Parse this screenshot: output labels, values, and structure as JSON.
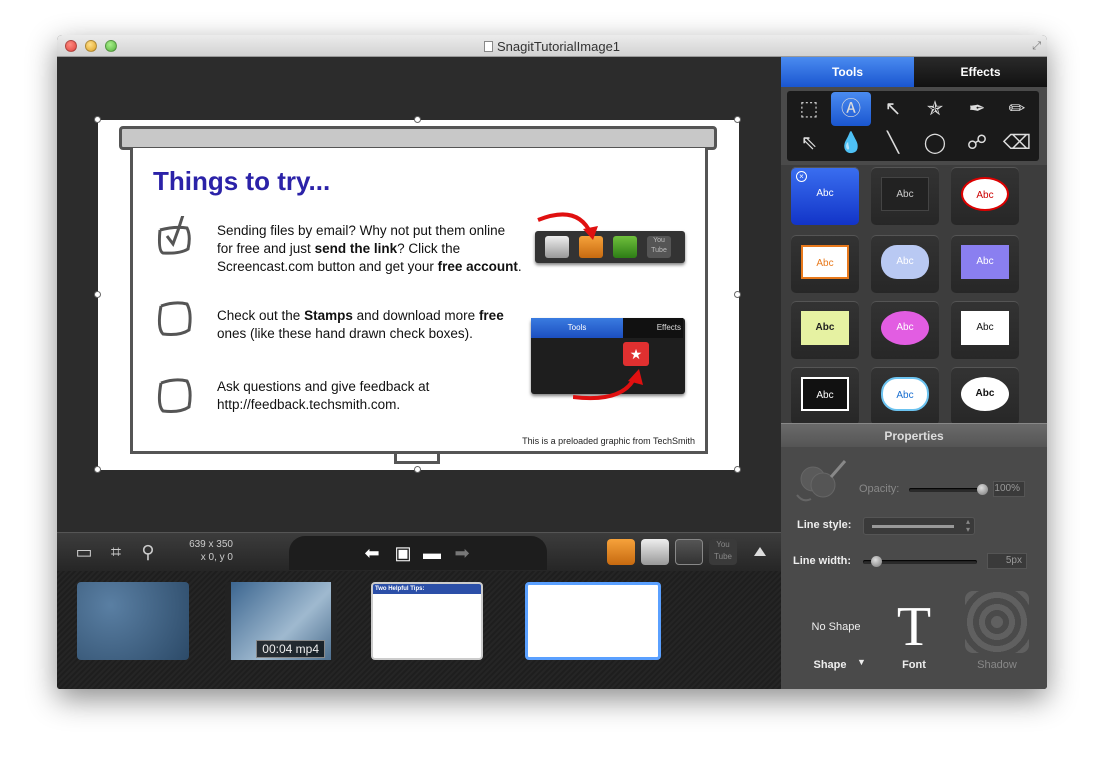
{
  "window": {
    "title": "SnagitTutorialImage1"
  },
  "slide": {
    "title": "Things to try...",
    "items": [
      {
        "text_a": "Sending files by email? Why not put them online for free and just ",
        "bold_a": "send the link",
        "text_b": "? Click the Screencast.com button and get your ",
        "bold_b": "free account",
        "text_c": "."
      },
      {
        "text_a": "Check out the ",
        "bold_a": "Stamps",
        "text_b": " and download more ",
        "bold_b": "free",
        "text_c": " ones (like these hand drawn check boxes)."
      },
      {
        "text_a": "Ask questions and give feedback at http://feedback.techsmith.com."
      }
    ],
    "mini_tools_tab": "Tools",
    "mini_effects_tab": "Effects",
    "mini_youtube": "You Tube",
    "footer_note": "This is a preloaded graphic from TechSmith"
  },
  "status": {
    "dimensions": "639 x 350",
    "position": "x 0,  y 0"
  },
  "share": {
    "youtube": "You Tube"
  },
  "tray": {
    "video_label": "00:04 mp4",
    "tips_title": "Two Helpful Tips:"
  },
  "panel": {
    "tabs": [
      "Tools",
      "Effects"
    ],
    "styles": [
      {
        "label": "Abc",
        "color": "#ffffff"
      },
      {
        "label": "Abc",
        "color": "#ffffff"
      },
      {
        "label": "Abc",
        "color": "#cc0000"
      },
      {
        "label": "Abc",
        "color": "#e8791c"
      },
      {
        "label": "Abc",
        "color": "#ffffff"
      },
      {
        "label": "Abc",
        "color": "#ffffff"
      },
      {
        "label": "Abc",
        "color": "#222222"
      },
      {
        "label": "Abc",
        "color": "#ffffff"
      },
      {
        "label": "Abc",
        "color": "#111111"
      },
      {
        "label": "Abc",
        "color": "#ffffff"
      },
      {
        "label": "Abc",
        "color": "#1a6fd0"
      },
      {
        "label": "Abc",
        "color": "#111111"
      }
    ],
    "properties_title": "Properties",
    "opacity_label": "Opacity:",
    "opacity_value": "100%",
    "line_style_label": "Line style:",
    "line_width_label": "Line width:",
    "line_width_value": "5px",
    "no_shape": "No Shape",
    "shape_label": "Shape",
    "font_label": "Font",
    "shadow_label": "Shadow",
    "font_glyph": "T"
  },
  "colors": {
    "accent_blue": "#1a56d0",
    "slide_title": "#2b22a8"
  },
  "icons": [
    "close-icon",
    "minimize-icon",
    "zoom-icon",
    "fullscreen-icon",
    "histogram-icon",
    "crop-icon",
    "search-icon",
    "back-arrow-icon",
    "library-icon",
    "folder-icon",
    "forward-arrow-icon",
    "screencast-icon",
    "email-icon",
    "excel-icon",
    "youtube-icon"
  ]
}
